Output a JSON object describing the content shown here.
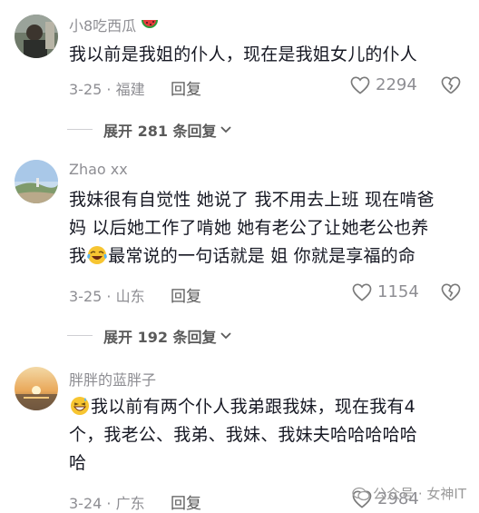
{
  "comments": [
    {
      "author": "小8吃西瓜",
      "author_emoji": "watermelon-icon",
      "lines": [
        "我以前是我姐的仆人，现在是我姐女儿的仆人"
      ],
      "date": "3-25",
      "location": "福建",
      "reply_label": "回复",
      "likes": "2294",
      "expand": "展开 281 条回复"
    },
    {
      "author": "Zhao xx",
      "lines": [
        "我妹很有自觉性 她说了 我不用去上班 现在啃爸",
        "妈 以后她工作了啃她 她有老公了让她老公也养",
        "最常说的一句话就是 姐 你就是享福的命"
      ],
      "line3_prefix": "我",
      "date": "3-25",
      "location": "山东",
      "reply_label": "回复",
      "likes": "1154",
      "expand": "展开 192 条回复"
    },
    {
      "author": "胖胖的蓝胖子",
      "lines": [
        "我以前有两个仆人我弟跟我妹，现在我有4",
        "个，我老公、我弟、我妹、我妹夫哈哈哈哈哈",
        "哈"
      ],
      "date": "3-24",
      "location": "广东",
      "reply_label": "回复",
      "likes": "2984"
    }
  ],
  "watermark": "公众号 · 女神IT",
  "colors": {
    "text": "#161823",
    "meta": "#8e8e93",
    "divider": "#cfcfd3"
  }
}
